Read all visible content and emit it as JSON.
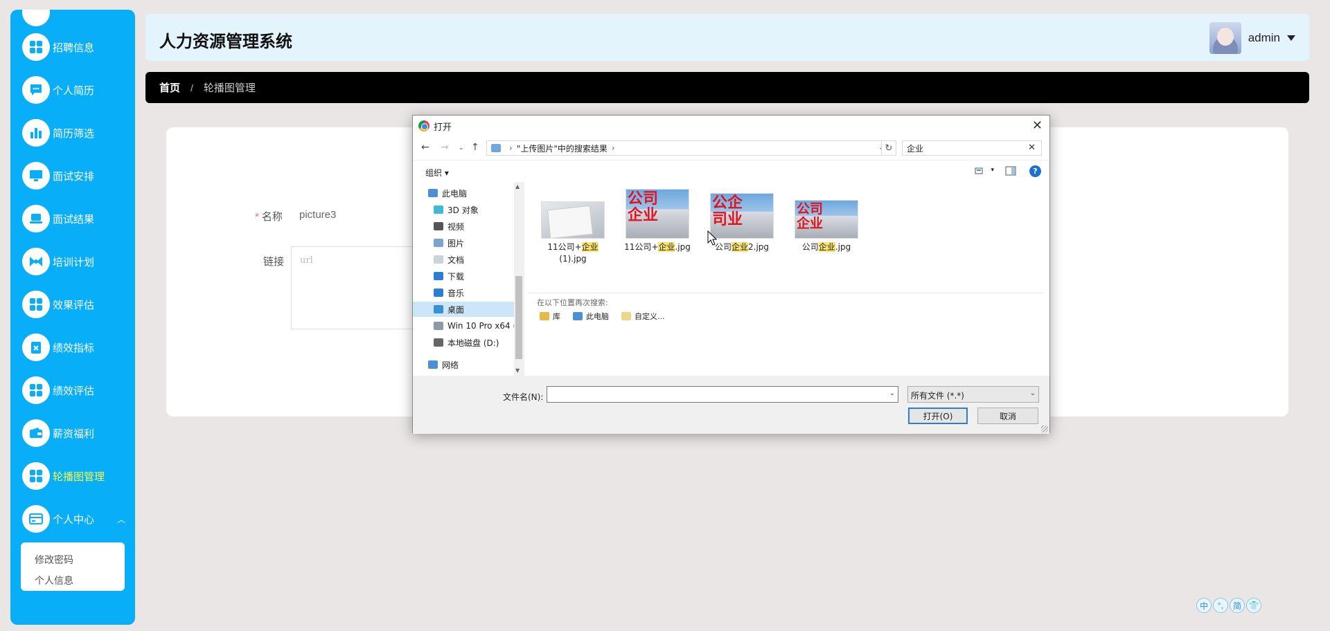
{
  "app": {
    "title": "人力资源管理系统",
    "username": "admin"
  },
  "sidebar": {
    "items": [
      {
        "label": "招聘信息",
        "icon": "grid-icon"
      },
      {
        "label": "个人简历",
        "icon": "chat-icon"
      },
      {
        "label": "简历筛选",
        "icon": "bar-chart-icon"
      },
      {
        "label": "面试安排",
        "icon": "monitor-icon"
      },
      {
        "label": "面试结果",
        "icon": "laptop-icon"
      },
      {
        "label": "培训计划",
        "icon": "bow-icon"
      },
      {
        "label": "效果评估",
        "icon": "grid-icon"
      },
      {
        "label": "绩效指标",
        "icon": "clipboard-icon"
      },
      {
        "label": "绩效评估",
        "icon": "grid-icon"
      },
      {
        "label": "薪资福利",
        "icon": "wallet-icon"
      },
      {
        "label": "轮播图管理",
        "icon": "grid-icon"
      },
      {
        "label": "个人中心",
        "icon": "card-icon"
      }
    ],
    "submenu": [
      "修改密码",
      "个人信息"
    ]
  },
  "breadcrumb": {
    "home": "首页",
    "separator": "/",
    "current": "轮播图管理"
  },
  "form": {
    "name_label": "名称",
    "name_value": "picture3",
    "link_label": "链接",
    "link_placeholder": "url"
  },
  "dialog": {
    "title": "打开",
    "address": "\"上传图片\"中的搜索结果",
    "search_value": "企业",
    "organize": "组织",
    "tree": [
      {
        "label": "此电脑",
        "icon": "pc-icon"
      },
      {
        "label": "3D 对象",
        "icon": "cube-icon"
      },
      {
        "label": "视频",
        "icon": "video-icon"
      },
      {
        "label": "图片",
        "icon": "picture-icon"
      },
      {
        "label": "文档",
        "icon": "document-icon"
      },
      {
        "label": "下载",
        "icon": "download-icon"
      },
      {
        "label": "音乐",
        "icon": "music-icon"
      },
      {
        "label": "桌面",
        "icon": "desktop-icon"
      },
      {
        "label": "Win 10 Pro x64 (",
        "icon": "drive-icon"
      },
      {
        "label": "本地磁盘 (D:)",
        "icon": "drive-icon"
      },
      {
        "label": "网络",
        "icon": "network-icon"
      }
    ],
    "files": [
      {
        "pre": "11公司+",
        "hl": "企业",
        "post": "(1).jpg"
      },
      {
        "pre": "11公司+",
        "hl": "企业",
        "post": ".jpg"
      },
      {
        "pre": "公司",
        "hl": "企业",
        "post": "2.jpg"
      },
      {
        "pre": "公司",
        "hl": "企业",
        "post": ".jpg"
      }
    ],
    "thumb_texts": [
      "公司\n企业",
      "公企\n司业",
      "公司\n企业"
    ],
    "search_again_label": "在以下位置再次搜索:",
    "search_locations": [
      "库",
      "此电脑",
      "自定义..."
    ],
    "filename_label": "文件名(N):",
    "filename_value": "",
    "filetype_value": "所有文件 (*.*)",
    "open_button": "打开(O)",
    "cancel_button": "取消"
  },
  "ime": [
    "中",
    "°,",
    "简",
    "👕"
  ],
  "colors": {
    "sidebar": "#08aef8",
    "active_menu_text": "#f5f94a",
    "header_bg": "#e3f4fd",
    "breadcrumb_bg": "#000000",
    "highlight": "#fbe26b"
  }
}
